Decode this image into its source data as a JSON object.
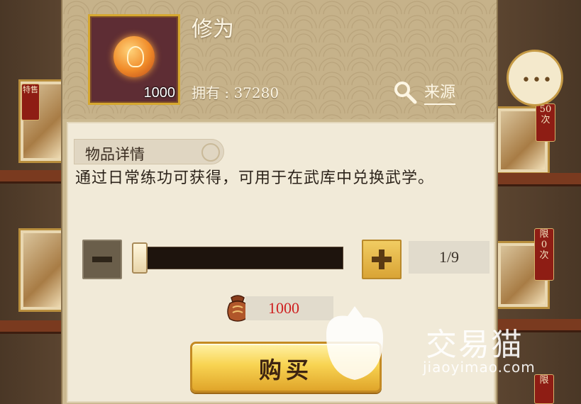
{
  "item": {
    "name": "修为",
    "quantity_badge": "1000",
    "owned_text": "拥有 : 37280",
    "source_label": "来源"
  },
  "details": {
    "section_title": "物品详情",
    "description": "通过日常练功可获得，可用于在武库中兑换武学。"
  },
  "purchase": {
    "counter": "1/9",
    "slider_level": 0.0,
    "cost": "1000",
    "buy_label": "购买"
  },
  "background": {
    "badge_right_top": "50\n次",
    "badge_right_mid": "限\n0\n次",
    "badge_right_bottom": "限",
    "badge_left": "特售"
  },
  "watermark": {
    "brand_cn": "交易猫",
    "brand_url": "jiaoyimao.com"
  },
  "icons": {
    "item": "cultivation-orb-icon",
    "search": "magnifier-icon",
    "chat": "chat-bubble-icon",
    "cost": "currency-bag-icon",
    "minus": "minus-icon",
    "plus": "plus-icon"
  },
  "colors": {
    "accent_gold": "#d6a82f",
    "cost_red": "#cf1f1f",
    "panel_bg": "#f1ead8"
  }
}
